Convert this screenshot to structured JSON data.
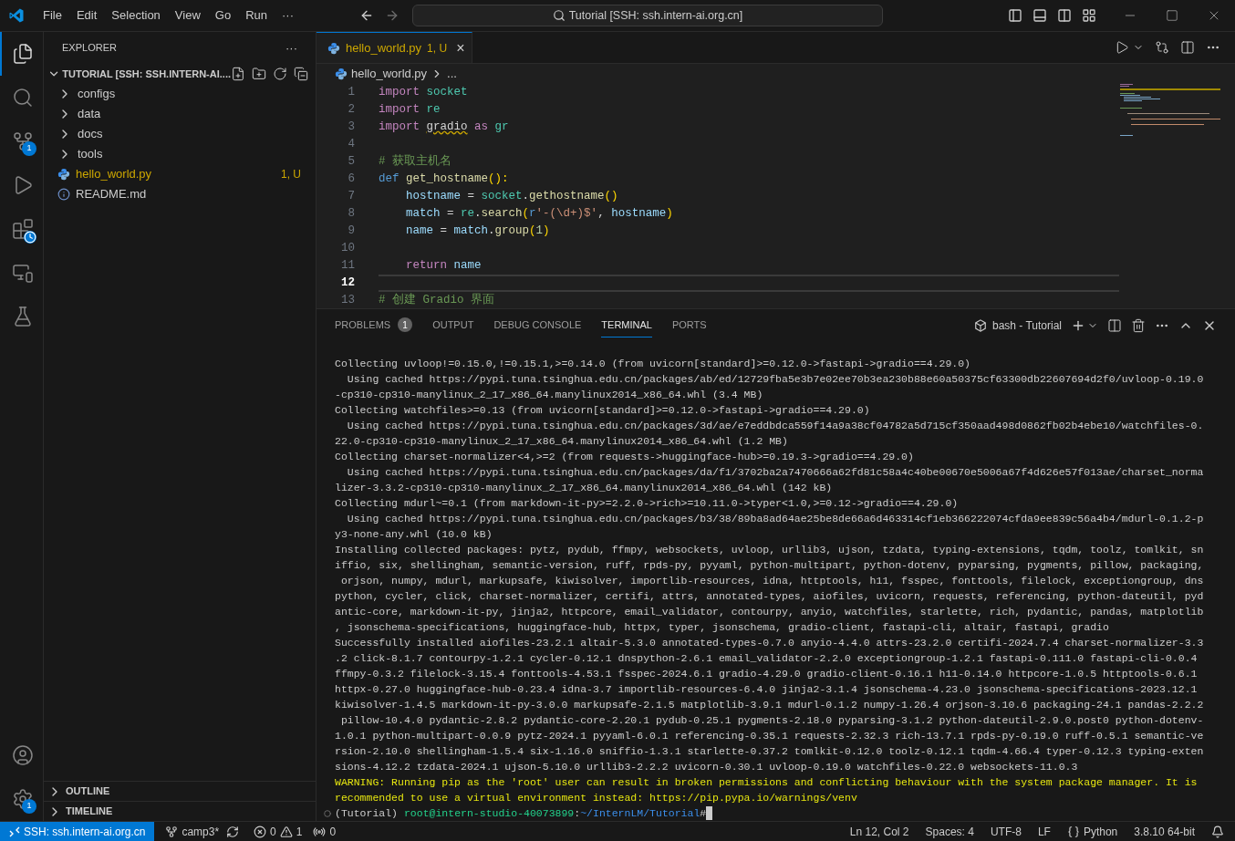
{
  "title_bar": {
    "menu": [
      "File",
      "Edit",
      "Selection",
      "View",
      "Go",
      "Run",
      "···"
    ],
    "search": "Tutorial [SSH: ssh.intern-ai.org.cn]"
  },
  "activity_bar": {
    "items": [
      {
        "kind": "explorer",
        "selected": true
      },
      {
        "kind": "search",
        "selected": false
      },
      {
        "kind": "source-control",
        "selected": false,
        "badge": "1"
      },
      {
        "kind": "run",
        "selected": false
      },
      {
        "kind": "extensions",
        "selected": false
      },
      {
        "kind": "remote",
        "selected": false
      },
      {
        "kind": "testing",
        "selected": false
      }
    ],
    "bottom": [
      {
        "kind": "account"
      },
      {
        "kind": "settings",
        "badge": "1"
      }
    ]
  },
  "sidebar": {
    "title": "EXPLORER",
    "more": "···",
    "root": "TUTORIAL [SSH: SSH.INTERN-AI....",
    "expanded": true,
    "items": [
      {
        "kind": "folder",
        "label": "configs",
        "expanded": false
      },
      {
        "kind": "folder",
        "label": "data",
        "expanded": false
      },
      {
        "kind": "folder",
        "label": "docs",
        "expanded": false
      },
      {
        "kind": "folder",
        "label": "tools",
        "expanded": false
      },
      {
        "kind": "python",
        "label": "hello_world.py",
        "status": "1, U",
        "modified": true
      },
      {
        "kind": "info",
        "label": "README.md",
        "modified": false
      }
    ],
    "sections": [
      {
        "label": "OUTLINE",
        "expanded": false
      },
      {
        "label": "TIMELINE",
        "expanded": false
      }
    ]
  },
  "editor": {
    "tabs": [
      {
        "label": "hello_world.py",
        "status": "1, U",
        "selected": true,
        "close": "×"
      }
    ],
    "breadcrumb": [
      "hello_world.py",
      "..."
    ],
    "lines": [
      {
        "n": "1",
        "active": false,
        "tokens": [
          {
            "t": "import ",
            "kind": "keyword"
          },
          {
            "t": "socket",
            "kind": "module"
          }
        ]
      },
      {
        "n": "2",
        "active": false,
        "tokens": [
          {
            "t": "import ",
            "kind": "keyword"
          },
          {
            "t": "re",
            "kind": "module"
          }
        ]
      },
      {
        "n": "3",
        "active": false,
        "tokens": [
          {
            "t": "import ",
            "kind": "keyword"
          },
          {
            "t": "gradio",
            "kind": "text",
            "squiggle": true
          },
          {
            "t": " as ",
            "kind": "keyword"
          },
          {
            "t": "gr",
            "kind": "module"
          }
        ]
      },
      {
        "n": "4",
        "active": false
      },
      {
        "n": "5",
        "active": false,
        "tokens": [
          {
            "t": "# 获取主机名",
            "kind": "comment"
          }
        ]
      },
      {
        "n": "6",
        "active": false,
        "tokens": [
          {
            "t": "def ",
            "kind": "storage"
          },
          {
            "t": "get_hostname",
            "kind": "function"
          },
          {
            "t": "():",
            "kind": "paren"
          }
        ]
      },
      {
        "n": "7",
        "active": false,
        "tokens": [
          {
            "t": "    hostname",
            "kind": "variable"
          },
          {
            "t": " = ",
            "kind": "text"
          },
          {
            "t": "socket",
            "kind": "module"
          },
          {
            "t": ".",
            "kind": "text"
          },
          {
            "t": "gethostname",
            "kind": "function"
          },
          {
            "t": "()",
            "kind": "paren"
          }
        ]
      },
      {
        "n": "8",
        "active": false,
        "tokens": [
          {
            "t": "    match",
            "kind": "variable"
          },
          {
            "t": " = ",
            "kind": "text"
          },
          {
            "t": "re",
            "kind": "module"
          },
          {
            "t": ".",
            "kind": "text"
          },
          {
            "t": "search",
            "kind": "function"
          },
          {
            "t": "(",
            "kind": "paren"
          },
          {
            "t": "r",
            "kind": "storage"
          },
          {
            "t": "'-(\\d+)$'",
            "kind": "string"
          },
          {
            "t": ", ",
            "kind": "text"
          },
          {
            "t": "hostname",
            "kind": "variable"
          },
          {
            "t": ")",
            "kind": "paren"
          }
        ]
      },
      {
        "n": "9",
        "active": false,
        "tokens": [
          {
            "t": "    name",
            "kind": "variable"
          },
          {
            "t": " = ",
            "kind": "text"
          },
          {
            "t": "match",
            "kind": "variable"
          },
          {
            "t": ".",
            "kind": "text"
          },
          {
            "t": "group",
            "kind": "function"
          },
          {
            "t": "(",
            "kind": "paren"
          },
          {
            "t": "1",
            "kind": "number"
          },
          {
            "t": ")",
            "kind": "paren"
          }
        ]
      },
      {
        "n": "10",
        "active": false
      },
      {
        "n": "11",
        "active": false,
        "tokens": [
          {
            "t": "    return ",
            "kind": "keyword"
          },
          {
            "t": "name",
            "kind": "variable"
          }
        ]
      },
      {
        "n": "12",
        "active": true
      },
      {
        "n": "13",
        "active": false,
        "tokens": [
          {
            "t": "# 创建 Gradio 界面",
            "kind": "comment"
          }
        ]
      }
    ]
  },
  "panel": {
    "tabs": [
      {
        "label": "PROBLEMS",
        "selected": false,
        "badge": "1"
      },
      {
        "label": "OUTPUT",
        "selected": false
      },
      {
        "label": "DEBUG CONSOLE",
        "selected": false
      },
      {
        "label": "TERMINAL",
        "selected": true
      },
      {
        "label": "PORTS",
        "selected": false
      }
    ],
    "terminal_name": "bash - Tutorial",
    "lines": [
      {
        "kind": "normal",
        "text": "Collecting uvloop!=0.15.0,!=0.15.1,>=0.14.0 (from uvicorn[standard]>=0.12.0->fastapi->gradio==4.29.0)"
      },
      {
        "kind": "normal",
        "text": "  Using cached https://pypi.tuna.tsinghua.edu.cn/packages/ab/ed/12729fba5e3b7e02ee70b3ea230b88e60a50375cf63300db22607694d2f0/uvloop-0.19.0"
      },
      {
        "kind": "normal",
        "text": "-cp310-cp310-manylinux_2_17_x86_64.manylinux2014_x86_64.whl (3.4 MB)"
      },
      {
        "kind": "normal",
        "text": "Collecting watchfiles>=0.13 (from uvicorn[standard]>=0.12.0->fastapi->gradio==4.29.0)"
      },
      {
        "kind": "normal",
        "text": "  Using cached https://pypi.tuna.tsinghua.edu.cn/packages/3d/ae/e7eddbdca559f14a9a38cf04782a5d715cf350aad498d0862fb02b4ebe10/watchfiles-0."
      },
      {
        "kind": "normal",
        "text": "22.0-cp310-cp310-manylinux_2_17_x86_64.manylinux2014_x86_64.whl (1.2 MB)"
      },
      {
        "kind": "normal",
        "text": "Collecting charset-normalizer<4,>=2 (from requests->huggingface-hub>=0.19.3->gradio==4.29.0)"
      },
      {
        "kind": "normal",
        "text": "  Using cached https://pypi.tuna.tsinghua.edu.cn/packages/da/f1/3702ba2a7470666a62fd81c58a4c40be00670e5006a67f4d626e57f013ae/charset_norma"
      },
      {
        "kind": "normal",
        "text": "lizer-3.3.2-cp310-cp310-manylinux_2_17_x86_64.manylinux2014_x86_64.whl (142 kB)"
      },
      {
        "kind": "normal",
        "text": "Collecting mdurl~=0.1 (from markdown-it-py>=2.2.0->rich>=10.11.0->typer<1.0,>=0.12->gradio==4.29.0)"
      },
      {
        "kind": "normal",
        "text": "  Using cached https://pypi.tuna.tsinghua.edu.cn/packages/b3/38/89ba8ad64ae25be8de66a6d463314cf1eb366222074cfda9ee839c56a4b4/mdurl-0.1.2-p"
      },
      {
        "kind": "normal",
        "text": "y3-none-any.whl (10.0 kB)"
      },
      {
        "kind": "normal",
        "text": "Installing collected packages: pytz, pydub, ffmpy, websockets, uvloop, urllib3, ujson, tzdata, typing-extensions, tqdm, toolz, tomlkit, sn"
      },
      {
        "kind": "normal",
        "text": "iffio, six, shellingham, semantic-version, ruff, rpds-py, pyyaml, python-multipart, python-dotenv, pyparsing, pygments, pillow, packaging,"
      },
      {
        "kind": "normal",
        "text": " orjson, numpy, mdurl, markupsafe, kiwisolver, importlib-resources, idna, httptools, h11, fsspec, fonttools, filelock, exceptiongroup, dns"
      },
      {
        "kind": "normal",
        "text": "python, cycler, click, charset-normalizer, certifi, attrs, annotated-types, aiofiles, uvicorn, requests, referencing, python-dateutil, pyd"
      },
      {
        "kind": "normal",
        "text": "antic-core, markdown-it-py, jinja2, httpcore, email_validator, contourpy, anyio, watchfiles, starlette, rich, pydantic, pandas, matplotlib"
      },
      {
        "kind": "normal",
        "text": ", jsonschema-specifications, huggingface-hub, httpx, typer, jsonschema, gradio-client, fastapi-cli, altair, fastapi, gradio"
      },
      {
        "kind": "normal",
        "text": "Successfully installed aiofiles-23.2.1 altair-5.3.0 annotated-types-0.7.0 anyio-4.4.0 attrs-23.2.0 certifi-2024.7.4 charset-normalizer-3.3"
      },
      {
        "kind": "normal",
        "text": ".2 click-8.1.7 contourpy-1.2.1 cycler-0.12.1 dnspython-2.6.1 email_validator-2.2.0 exceptiongroup-1.2.1 fastapi-0.111.0 fastapi-cli-0.0.4"
      },
      {
        "kind": "normal",
        "text": "ffmpy-0.3.2 filelock-3.15.4 fonttools-4.53.1 fsspec-2024.6.1 gradio-4.29.0 gradio-client-0.16.1 h11-0.14.0 httpcore-1.0.5 httptools-0.6.1"
      },
      {
        "kind": "normal",
        "text": "httpx-0.27.0 huggingface-hub-0.23.4 idna-3.7 importlib-resources-6.4.0 jinja2-3.1.4 jsonschema-4.23.0 jsonschema-specifications-2023.12.1"
      },
      {
        "kind": "normal",
        "text": "kiwisolver-1.4.5 markdown-it-py-3.0.0 markupsafe-2.1.5 matplotlib-3.9.1 mdurl-0.1.2 numpy-1.26.4 orjson-3.10.6 packaging-24.1 pandas-2.2.2"
      },
      {
        "kind": "normal",
        "text": " pillow-10.4.0 pydantic-2.8.2 pydantic-core-2.20.1 pydub-0.25.1 pygments-2.18.0 pyparsing-3.1.2 python-dateutil-2.9.0.post0 python-dotenv-"
      },
      {
        "kind": "normal",
        "text": "1.0.1 python-multipart-0.0.9 pytz-2024.1 pyyaml-6.0.1 referencing-0.35.1 requests-2.32.3 rich-13.7.1 rpds-py-0.19.0 ruff-0.5.1 semantic-ve"
      },
      {
        "kind": "normal",
        "text": "rsion-2.10.0 shellingham-1.5.4 six-1.16.0 sniffio-1.3.1 starlette-0.37.2 tomlkit-0.12.0 toolz-0.12.1 tqdm-4.66.4 typer-0.12.3 typing-exten"
      },
      {
        "kind": "normal",
        "text": "sions-4.12.2 tzdata-2024.1 ujson-5.10.0 urllib3-2.2.2 uvicorn-0.30.1 uvloop-0.19.0 watchfiles-0.22.0 websockets-11.0.3"
      },
      {
        "kind": "warning",
        "text": "WARNING: Running pip as the 'root' user can result in broken permissions and conflicting behaviour with the system package manager. It is"
      },
      {
        "kind": "warning",
        "text": "recommended to use a virtual environment instead: https://pip.pypa.io/warnings/venv"
      }
    ],
    "prompt": {
      "env": "(Tutorial) ",
      "user": "root@intern-studio-40073899",
      "sep": ":",
      "path": "~/InternLM/Tutorial",
      "symbol": "#"
    }
  },
  "status_bar": {
    "remote": "SSH: ssh.intern-ai.org.cn",
    "branch": "camp3*",
    "errors": "0",
    "warnings": "1",
    "ports": "0",
    "right": [
      "Ln 12, Col 2",
      "Spaces: 4",
      "UTF-8",
      "LF",
      "Python",
      "3.8.10 64-bit"
    ]
  }
}
